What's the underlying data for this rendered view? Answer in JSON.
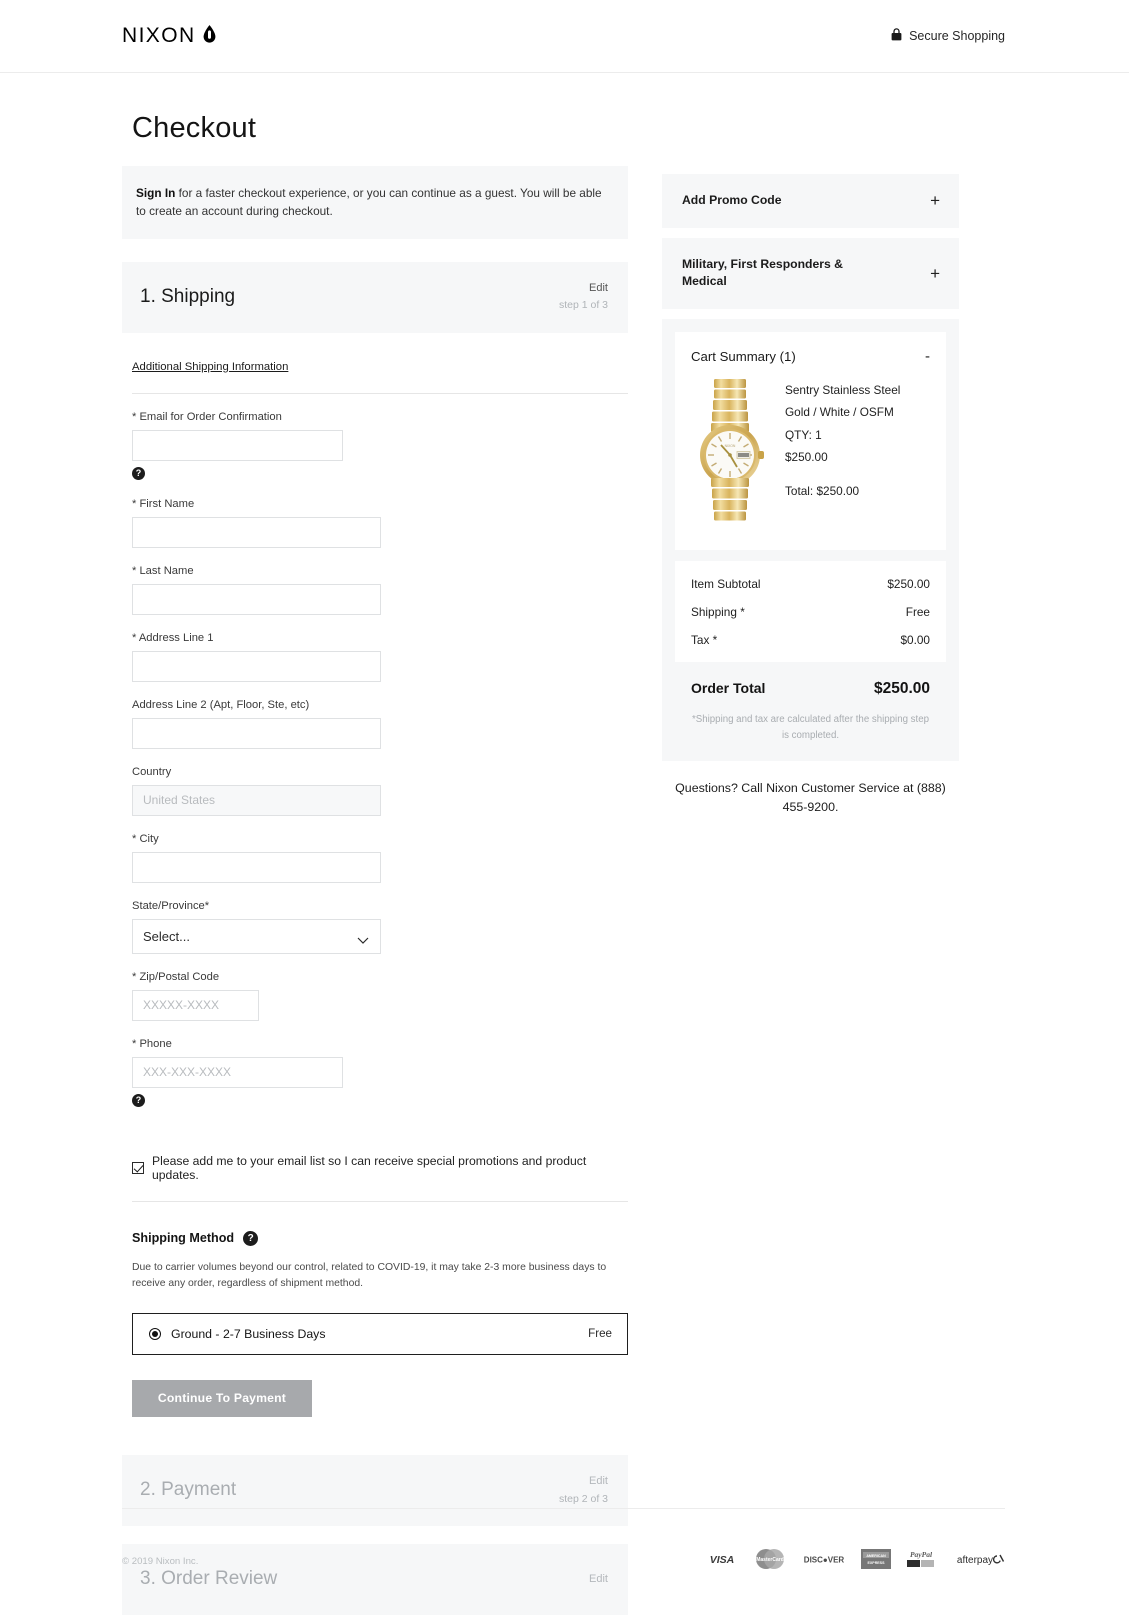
{
  "header": {
    "brand": "NIXON",
    "brand_icon": "droplet-icon",
    "secure_label": "Secure Shopping",
    "secure_icon": "lock-icon"
  },
  "page": {
    "title": "Checkout"
  },
  "signin_banner": {
    "link_label": "Sign In",
    "text": " for a faster checkout experience, or you can continue as a guest. You will be able to create an account during checkout."
  },
  "steps": [
    {
      "title": "1. Shipping",
      "edit": "Edit",
      "count": "step 1 of 3"
    },
    {
      "title": "2. Payment",
      "edit": "Edit",
      "count": "step 2 of 3"
    },
    {
      "title": "3. Order Review",
      "edit": "Edit",
      "count": ""
    }
  ],
  "shipping_form": {
    "additional_link": "Additional Shipping Information",
    "fields": {
      "email": {
        "label": "* Email for Order Confirmation",
        "value": "",
        "placeholder": ""
      },
      "first_name": {
        "label": "* First Name",
        "value": "",
        "placeholder": ""
      },
      "last_name": {
        "label": "* Last Name",
        "value": "",
        "placeholder": ""
      },
      "address1": {
        "label": "* Address Line 1",
        "value": "",
        "placeholder": ""
      },
      "address2": {
        "label": "Address Line 2 (Apt, Floor, Ste, etc)",
        "value": "",
        "placeholder": ""
      },
      "country": {
        "label": "Country",
        "value": "",
        "placeholder": "United States"
      },
      "city": {
        "label": "* City",
        "value": "",
        "placeholder": ""
      },
      "state": {
        "label": "State/Province*",
        "selected": "Select...",
        "options": [
          "Select..."
        ]
      },
      "zip": {
        "label": "* Zip/Postal Code",
        "value": "",
        "placeholder": "XXXXX-XXXX"
      },
      "phone": {
        "label": "* Phone",
        "value": "",
        "placeholder": "XXX-XXX-XXXX"
      }
    },
    "optin_label": "Please add me to your email list so I can receive special promotions and product updates.",
    "optin_checked": true
  },
  "shipping_method": {
    "heading": "Shipping Method",
    "notice": "Due to carrier volumes beyond our control, related to COVID-19, it may take 2-3 more business days to receive any order, regardless of shipment method.",
    "option_label": "Ground - 2-7 Business Days",
    "option_price": "Free",
    "option_selected": true,
    "continue_label": "Continue To Payment"
  },
  "sidebar": {
    "promo": {
      "label": "Add Promo Code",
      "toggle": "+"
    },
    "military": {
      "label": "Military, First Responders & Medical",
      "toggle": "+"
    },
    "cart": {
      "title": "Cart Summary (1)",
      "toggle": "-",
      "item": {
        "name": "Sentry Stainless Steel",
        "variant": "Gold / White / OSFM",
        "qty": "QTY: 1",
        "price": "$250.00",
        "total": "Total: $250.00",
        "image_alt": "gold-watch-thumbnail"
      }
    },
    "totals": [
      {
        "label": "Item Subtotal",
        "value": "$250.00"
      },
      {
        "label": "Shipping *",
        "value": "Free"
      },
      {
        "label": "Tax *",
        "value": "$0.00"
      }
    ],
    "order_total": {
      "label": "Order Total",
      "value": "$250.00"
    },
    "totals_note": "*Shipping and tax are calculated after the shipping step is completed.",
    "customer_service": "Questions? Call Nixon Customer Service at (888) 455-9200."
  },
  "footer": {
    "copyright": "© 2019 Nixon Inc.",
    "payment_methods": [
      "VISA",
      "MasterCard",
      "DISCOVER",
      "AMERICAN EXPRESS",
      "PayPal",
      "afterpay"
    ]
  },
  "colors": {
    "panel_bg": "#f6f7f8",
    "border": "#dfe1e3",
    "disabled_button": "#a7a9ac",
    "muted_text": "#a9adb1"
  }
}
